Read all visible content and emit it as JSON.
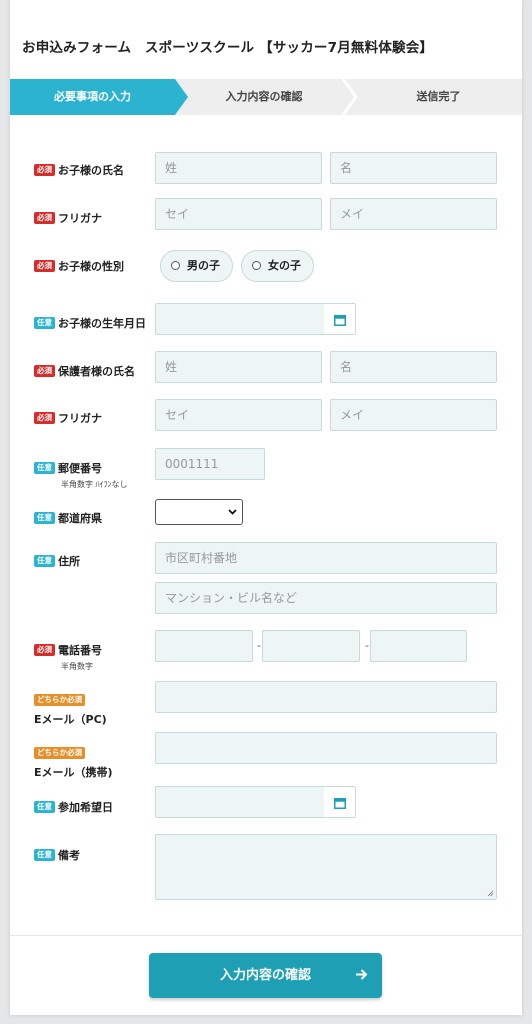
{
  "form": {
    "title": "お申込みフォーム　スポーツスクール 【サッカー7月無料体験会】"
  },
  "steps": [
    {
      "label": "必要事項の入力",
      "state": "active"
    },
    {
      "label": "入力内容の確認",
      "state": "inactive"
    },
    {
      "label": "送信完了",
      "state": "inactive"
    }
  ],
  "badges": {
    "required": "必須",
    "optional": "任意",
    "either": "どちらか必須"
  },
  "fields": {
    "child_name": {
      "label": "お子様の氏名",
      "last_placeholder": "姓",
      "first_placeholder": "名"
    },
    "child_kana": {
      "label": "フリガナ",
      "last_placeholder": "セイ",
      "first_placeholder": "メイ"
    },
    "child_gender": {
      "label": "お子様の性別",
      "options": [
        "男の子",
        "女の子"
      ]
    },
    "child_birthday": {
      "label": "お子様の生年月日",
      "value": ""
    },
    "guardian_name": {
      "label": "保護者様の氏名",
      "last_placeholder": "姓",
      "first_placeholder": "名"
    },
    "guardian_kana": {
      "label": "フリガナ",
      "last_placeholder": "セイ",
      "first_placeholder": "メイ"
    },
    "postal_code": {
      "label": "郵便番号",
      "note": "半角数字 ﾊｲﾌﾝなし",
      "placeholder": "0001111"
    },
    "prefecture": {
      "label": "都道府県",
      "selected": ""
    },
    "address": {
      "label": "住所",
      "line1_placeholder": "市区町村番地",
      "line2_placeholder": "マンション・ビル名など"
    },
    "phone": {
      "label": "電話番号",
      "note": "半角数字",
      "separator": "-"
    },
    "email_pc": {
      "label": "Eメール（PC)"
    },
    "email_mobile": {
      "label": "Eメール（携帯)"
    },
    "preferred_date": {
      "label": "参加希望日",
      "value": ""
    },
    "remarks": {
      "label": "備考"
    }
  },
  "submit": {
    "label": "入力内容の確認"
  },
  "icons": {
    "calendar": "calendar-icon",
    "select_arrow": "chevron-down-icon",
    "submit_arrow": "arrow-right-icon"
  },
  "colors": {
    "accent": "#2cb3cf",
    "required": "#d82c2c",
    "either": "#e7902b",
    "submit": "#1e9fb4",
    "input_bg": "#eef5f5"
  }
}
